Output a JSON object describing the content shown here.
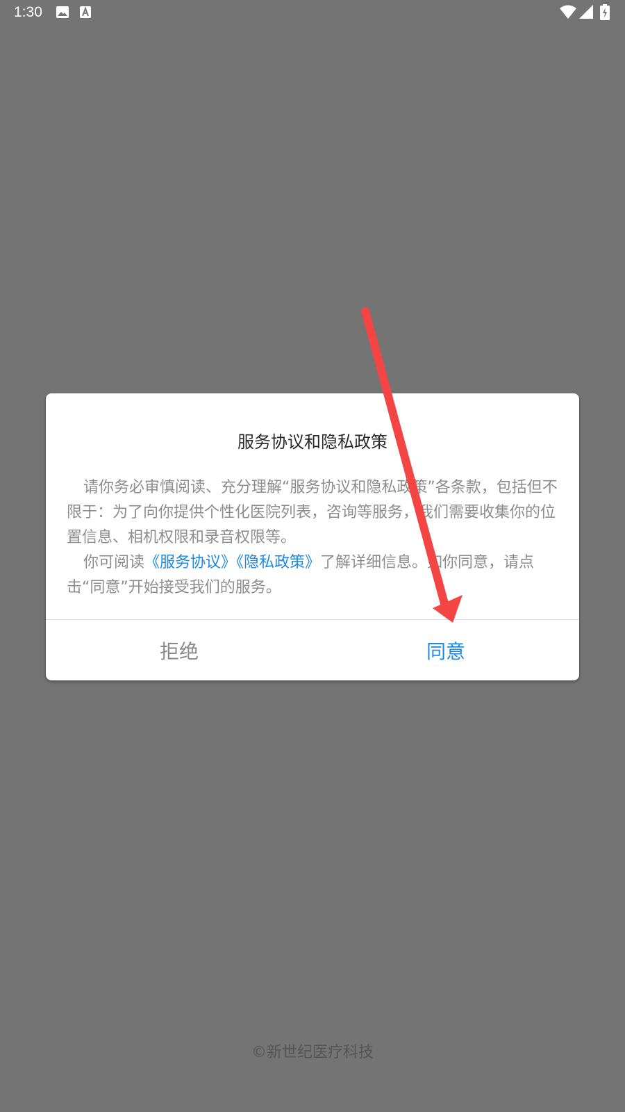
{
  "status_bar": {
    "time": "1:30",
    "icons": [
      "image-icon",
      "a-letter-icon",
      "wifi-icon",
      "signal-icon",
      "battery-charging-icon"
    ]
  },
  "dialog": {
    "title": "服务协议和隐私政策",
    "paragraph1": "请你务必审慎阅读、充分理解“服务协议和隐私政策”各条款，包括但不限于：为了向你提供个性化医院列表，咨询等服务，我们需要收集你的位置信息、相机权限和录音权限等。",
    "paragraph2_prefix": "你可阅读",
    "link_service": "《服务协议》",
    "link_privacy": "《隐私政策》",
    "paragraph2_suffix": "了解详细信息。如你同意，请点击“同意”开始接受我们的服务。",
    "reject_label": "拒绝",
    "agree_label": "同意"
  },
  "annotation": {
    "arrow_color": "#f44545"
  },
  "footer": {
    "copyright": "©新世纪医疗科技"
  },
  "colors": {
    "background": "#747474",
    "accent": "#1f8ae6",
    "muted_text": "#8d8d8d"
  }
}
